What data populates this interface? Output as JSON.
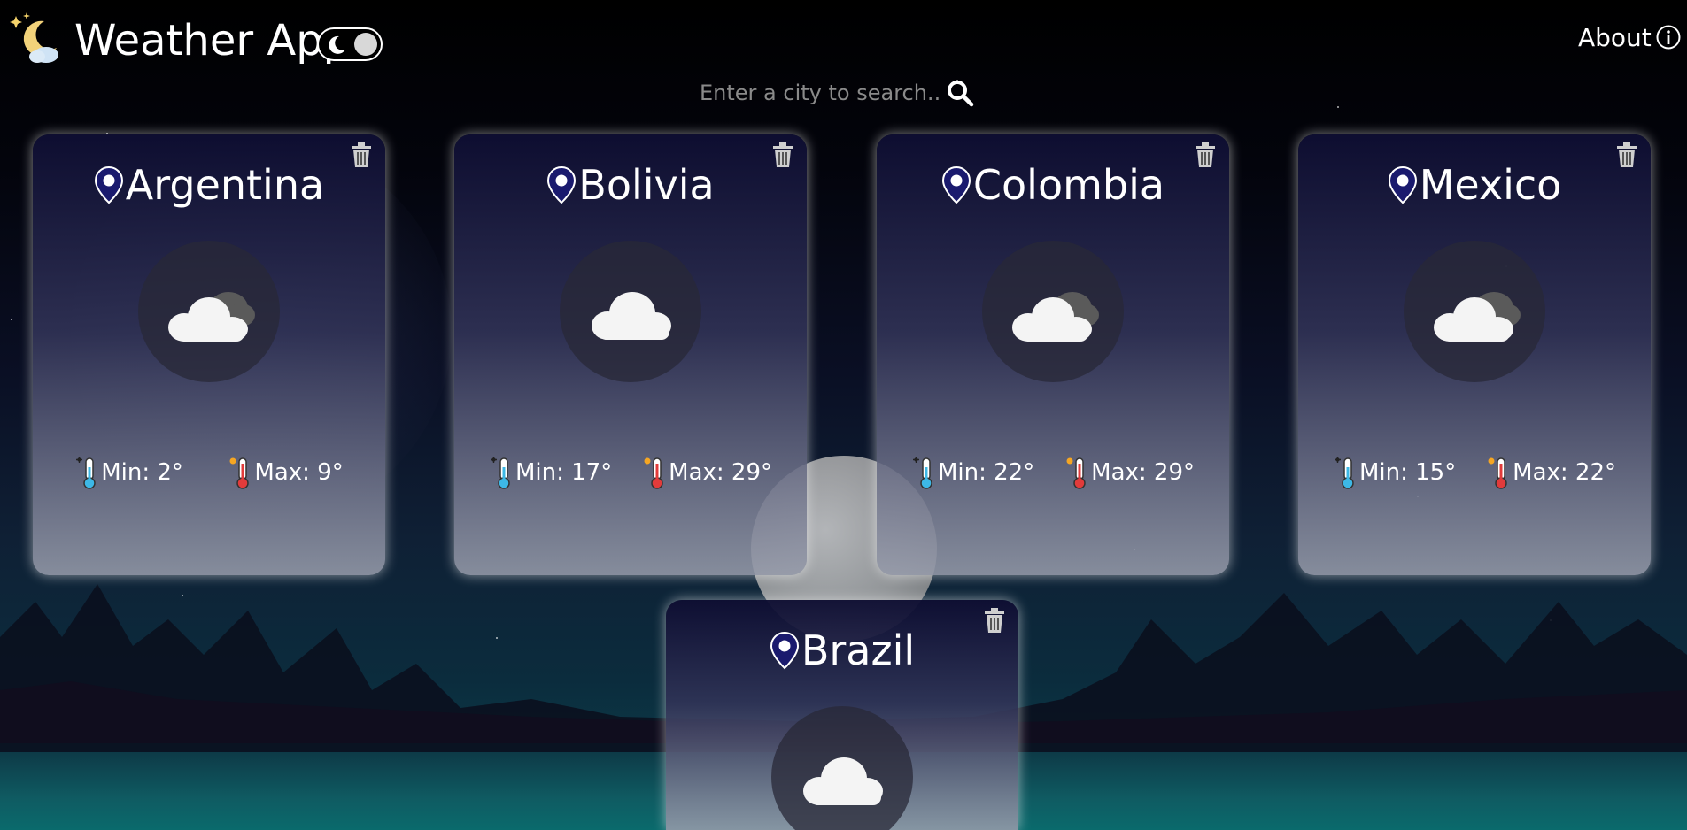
{
  "header": {
    "app_title": "Weather App",
    "about_label": "About"
  },
  "search": {
    "placeholder": "Enter a city to search..."
  },
  "cards": [
    {
      "city": "Argentina",
      "weather": "partly-cloudy",
      "min": "Min: 2°",
      "max": "Max: 9°"
    },
    {
      "city": "Bolivia",
      "weather": "cloudy",
      "min": "Min: 17°",
      "max": "Max: 29°"
    },
    {
      "city": "Colombia",
      "weather": "partly-cloudy",
      "min": "Min: 22°",
      "max": "Max: 29°"
    },
    {
      "city": "Mexico",
      "weather": "partly-cloudy",
      "min": "Min: 15°",
      "max": "Max: 22°"
    },
    {
      "city": "Brazil",
      "weather": "cloudy",
      "min": "",
      "max": ""
    }
  ],
  "icons": {
    "logo": "night-weather-logo-icon",
    "theme_toggle": "moon-icon",
    "about": "info-icon",
    "search": "search-icon",
    "delete": "trash-icon",
    "location": "location-pin-icon",
    "min_temp": "cold-thermometer-icon",
    "max_temp": "hot-thermometer-icon"
  },
  "colors": {
    "card_top": "#0e0e32",
    "card_bottom": "#969baa",
    "pin_fill": "#1a1a6e",
    "cold_thermo": "#3db8e6",
    "hot_thermo": "#e23b3b",
    "toggle_knob": "#d8d8d8"
  }
}
